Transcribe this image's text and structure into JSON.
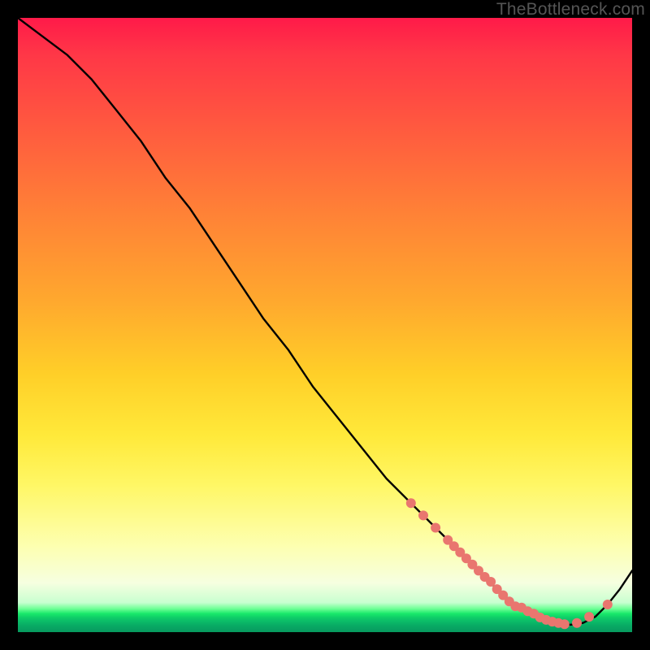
{
  "watermark": "TheBottleneck.com",
  "chart_data": {
    "type": "line",
    "title": "",
    "xlabel": "",
    "ylabel": "",
    "xlim": [
      0,
      100
    ],
    "ylim": [
      0,
      100
    ],
    "series": [
      {
        "name": "bottleneck-curve",
        "x": [
          0,
          4,
          8,
          12,
          16,
          20,
          24,
          28,
          32,
          36,
          40,
          44,
          48,
          52,
          56,
          60,
          64,
          68,
          72,
          74,
          76,
          78,
          80,
          82,
          84,
          86,
          88,
          90,
          92,
          94,
          96,
          98,
          100
        ],
        "y": [
          100,
          97,
          94,
          90,
          85,
          80,
          74,
          69,
          63,
          57,
          51,
          46,
          40,
          35,
          30,
          25,
          21,
          17,
          13,
          11,
          9,
          7,
          5,
          4,
          3,
          2,
          1.5,
          1.2,
          1.5,
          2.5,
          4.5,
          7,
          10
        ],
        "color": "#000000"
      }
    ],
    "markers": {
      "color": "#e9766f",
      "radius": 6,
      "points_x": [
        64,
        66,
        68,
        70,
        71,
        72,
        73,
        74,
        75,
        76,
        77,
        78,
        79,
        80,
        81,
        82,
        83,
        84,
        85,
        86,
        87,
        88,
        89,
        91,
        93,
        96
      ],
      "points_y": [
        21,
        19,
        17,
        15,
        14,
        13,
        12,
        11,
        10,
        9,
        8.2,
        7,
        6,
        5,
        4.2,
        4,
        3.4,
        3,
        2.4,
        2,
        1.7,
        1.5,
        1.3,
        1.5,
        2.5,
        4.5
      ]
    }
  }
}
